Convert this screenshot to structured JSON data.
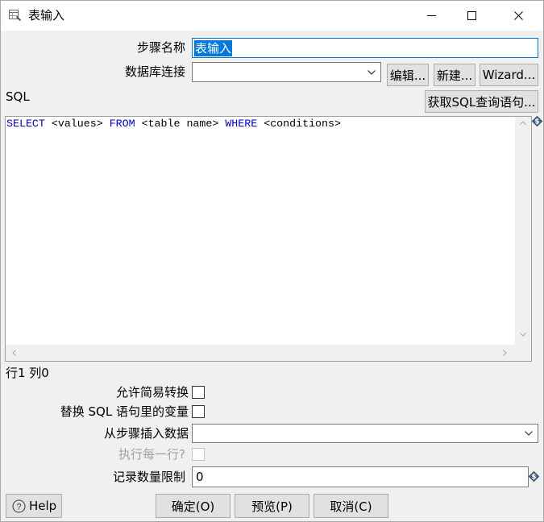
{
  "window": {
    "title": "表输入"
  },
  "step_name": {
    "label": "步骤名称",
    "value": "表输入"
  },
  "connection": {
    "label": "数据库连接",
    "value": "",
    "edit_button": "编辑...",
    "new_button": "新建...",
    "wizard_button": "Wizard..."
  },
  "sql": {
    "label": "SQL",
    "get_sql_button": "获取SQL查询语句...",
    "tokens": [
      {
        "text": "SELECT",
        "keyword": true
      },
      {
        "text": " <values> ",
        "keyword": false
      },
      {
        "text": "FROM",
        "keyword": true
      },
      {
        "text": " <table name> ",
        "keyword": false
      },
      {
        "text": "WHERE",
        "keyword": true
      },
      {
        "text": " <conditions>",
        "keyword": false
      }
    ],
    "cursor_position": "行1 列0"
  },
  "options": {
    "lazy_conversion": {
      "label": "允许简易转换",
      "checked": false
    },
    "replace_variables": {
      "label": "替换 SQL 语句里的变量",
      "checked": false
    },
    "insert_from_step": {
      "label": "从步骤插入数据",
      "value": ""
    },
    "execute_each_row": {
      "label": "执行每一行?",
      "checked": false,
      "enabled": false
    },
    "limit": {
      "label": "记录数量限制",
      "value": "0"
    }
  },
  "footer": {
    "help_button": "Help",
    "ok_button": "确定(O)",
    "preview_button": "预览(P)",
    "cancel_button": "取消(C)"
  },
  "icons": {
    "window": "table-input-icon",
    "minimize": "minimize-icon",
    "maximize": "maximize-icon",
    "close": "close-icon",
    "variable": "variable-dollar-icon",
    "dropdown": "chevron-down-icon",
    "help": "help-circle-icon"
  },
  "colors": {
    "sql_keyword": "#0000c0",
    "selection": "#0078d7",
    "focus_border": "#0078d7",
    "disabled_text": "#a0a0a0"
  }
}
